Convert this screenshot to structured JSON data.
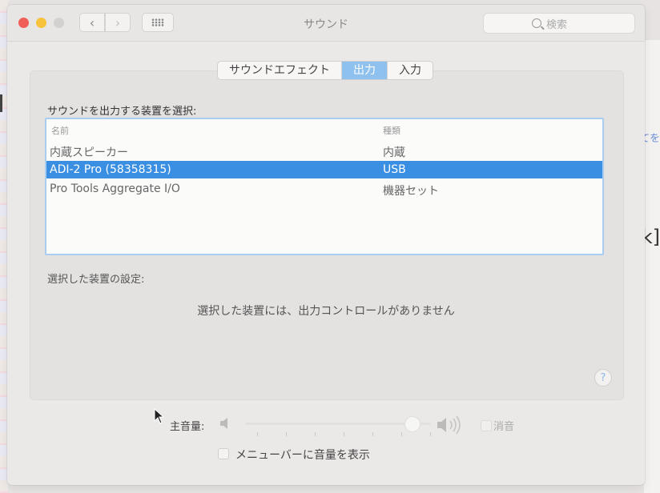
{
  "window": {
    "title": "サウンド",
    "search_placeholder": "検索"
  },
  "tabs": [
    {
      "label": "サウンドエフェクト",
      "active": false
    },
    {
      "label": "出力",
      "active": true
    },
    {
      "label": "入力",
      "active": false
    }
  ],
  "output": {
    "section_label": "サウンドを出力する装置を選択:",
    "columns": {
      "name": "名前",
      "type": "種類"
    },
    "devices": [
      {
        "name": "内蔵スピーカー",
        "type": "内蔵",
        "selected": false
      },
      {
        "name": "ADI-2 Pro (58358315)",
        "type": "USB",
        "selected": true
      },
      {
        "name": "Pro Tools Aggregate I/O",
        "type": "機器セット",
        "selected": false
      }
    ],
    "settings_label": "選択した装置の設定:",
    "no_controls_message": "選択した装置には、出力コントロールがありません"
  },
  "volume": {
    "label": "主音量:",
    "level": 0.9,
    "mute_label": "消音",
    "menubar_label": "メニューバーに音量を表示"
  },
  "help": {
    "label": "?"
  },
  "background": {
    "right_text_1": "てを",
    "right_text_2": "k]"
  },
  "colors": {
    "selection": "#3b8fe2",
    "tab_active": "#8fc1ef",
    "focus_ring": "#a9cdf0"
  }
}
